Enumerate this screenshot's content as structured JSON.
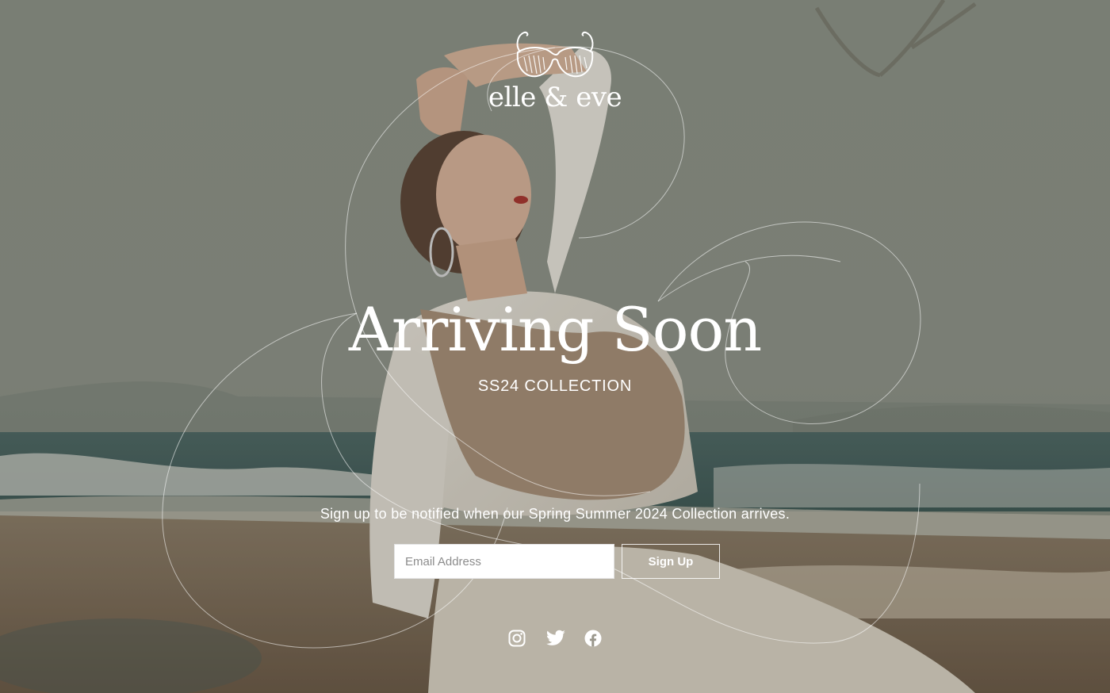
{
  "brand": {
    "name": "elle & eve",
    "logo_icon": "sunglasses-icon"
  },
  "hero": {
    "heading": "Arriving Soon",
    "subheading": "SS24 COLLECTION",
    "tagline": "Sign up to be notified when our Spring Summer 2024 Collection arrives."
  },
  "signup": {
    "email_placeholder": "Email Address",
    "email_value": "",
    "button_label": "Sign Up"
  },
  "social": [
    {
      "name": "Instagram",
      "icon": "instagram-icon"
    },
    {
      "name": "Twitter",
      "icon": "twitter-icon"
    },
    {
      "name": "Facebook",
      "icon": "facebook-icon"
    }
  ],
  "colors": {
    "text": "#ffffff",
    "sky": "#8e9388",
    "sea": "#3f5a56",
    "sand": "#8a7560",
    "input_bg": "#ffffff"
  }
}
